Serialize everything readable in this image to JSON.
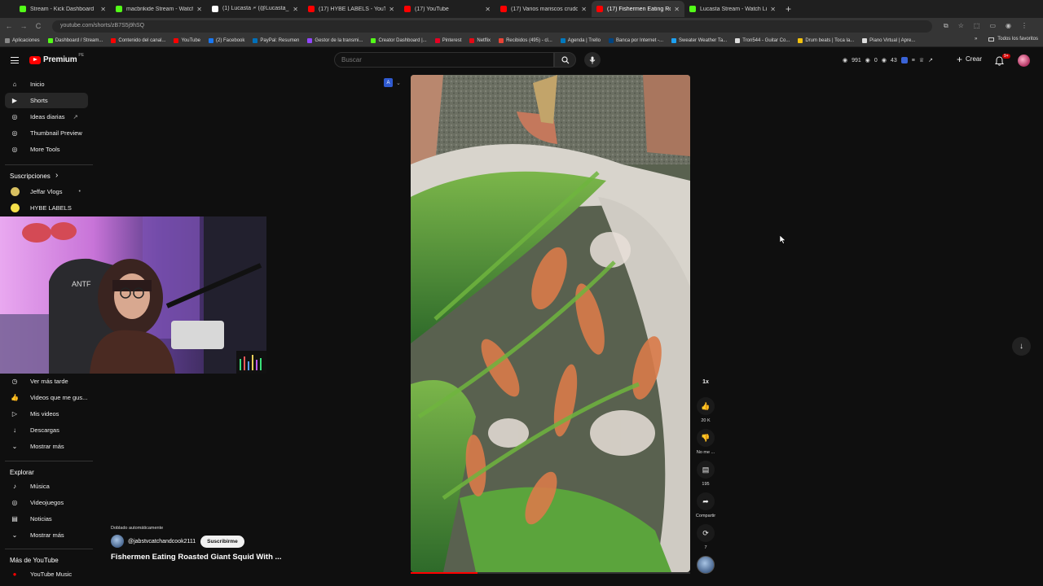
{
  "browser": {
    "tabs": [
      {
        "label": "Stream - Kick Dashboard",
        "favicon_color": "#53fc18",
        "close": "✕"
      },
      {
        "label": "macbrikide Stream - Watch Live",
        "favicon_color": "#53fc18",
        "close": "✕"
      },
      {
        "label": "(1) Lucasta 🗲 (@Lucasta_1) / X",
        "favicon_color": "#ffffff",
        "close": "✕"
      },
      {
        "label": "(17) HYBE LABELS - YouTube",
        "favicon_color": "#ff0000",
        "close": "✕"
      },
      {
        "label": "(17) YouTube",
        "favicon_color": "#ff0000",
        "close": "✕"
      },
      {
        "label": "(17) Varios mariscos crudos M...",
        "favicon_color": "#ff0000",
        "close": "✕"
      },
      {
        "label": "(17) Fishermen Eating Roas",
        "favicon_color": "#ff0000",
        "close": "✕",
        "active": true
      },
      {
        "label": "Lucasta Stream - Watch Live o",
        "favicon_color": "#53fc18",
        "close": "✕"
      }
    ],
    "new_tab": "+",
    "nav": {
      "back": "←",
      "forward": "→",
      "reload": "C"
    },
    "url": "youtube.com/shorts/zB7S5j9hSQ",
    "bookmarks": [
      {
        "label": "Aplicaciones",
        "color": "#888888"
      },
      {
        "label": "Dashboard / Stream...",
        "color": "#53fc18"
      },
      {
        "label": "Contenido del canal...",
        "color": "#ff0000"
      },
      {
        "label": "YouTube",
        "color": "#ff0000"
      },
      {
        "label": "(2) Facebook",
        "color": "#1877f2"
      },
      {
        "label": "PayPal: Resumen",
        "color": "#0070ba"
      },
      {
        "label": "Gestor de la transmi...",
        "color": "#9146ff"
      },
      {
        "label": "Creator Dashboard |...",
        "color": "#53fc18"
      },
      {
        "label": "Pinterest",
        "color": "#e60023"
      },
      {
        "label": "Netflix",
        "color": "#e50914"
      },
      {
        "label": "Recibidos (495) - cl...",
        "color": "#ea4335"
      },
      {
        "label": "Agenda | Trello",
        "color": "#0079bf"
      },
      {
        "label": "Banca por Internet -...",
        "color": "#004481"
      },
      {
        "label": "Sweater Weather Ta...",
        "color": "#1da1f2"
      },
      {
        "label": "Tron544 - Guitar Co...",
        "color": "#dddddd"
      },
      {
        "label": "Drum beats | Toca la...",
        "color": "#f4c20d"
      },
      {
        "label": "Piano Virtual | Apre...",
        "color": "#dddddd"
      }
    ],
    "bookmarks_more": "»",
    "all_bookmarks": "Todos los favoritos"
  },
  "youtube": {
    "logo_text": "Premium",
    "logo_sup": "PE",
    "search_placeholder": "Buscar",
    "stats": [
      "991",
      "0",
      "43"
    ],
    "create_label": "Crear",
    "notif_badge": "9+",
    "sidebar": {
      "main": [
        {
          "label": "Inicio",
          "icon": "home-icon",
          "glyph": "⌂"
        },
        {
          "label": "Shorts",
          "icon": "shorts-icon",
          "glyph": "▶",
          "active": true
        },
        {
          "label": "Ideas diarias",
          "icon": "lightbulb-icon",
          "glyph": "◎",
          "ext": "↗"
        },
        {
          "label": "Thumbnail Preview",
          "icon": "extension-icon",
          "glyph": "◎"
        },
        {
          "label": "More Tools",
          "icon": "tools-icon",
          "glyph": "◎"
        }
      ],
      "subs_header": "Suscripciones",
      "subs": [
        {
          "label": "Jeffar Vlogs",
          "color": "#d8c060",
          "dot": "•"
        },
        {
          "label": "HYBE LABELS",
          "color": "#f5e04a"
        }
      ],
      "you": [
        {
          "label": "Ver más tarde",
          "icon": "clock-icon",
          "glyph": "◷"
        },
        {
          "label": "Videos que me gus...",
          "icon": "like-icon",
          "glyph": "👍"
        },
        {
          "label": "Mis videos",
          "icon": "my-videos-icon",
          "glyph": "▷"
        },
        {
          "label": "Descargas",
          "icon": "download-icon",
          "glyph": "↓"
        },
        {
          "label": "Mostrar más",
          "icon": "chevron-down-icon",
          "glyph": "⌄"
        }
      ],
      "explore_header": "Explorar",
      "explore": [
        {
          "label": "Música",
          "icon": "music-icon",
          "glyph": "♪"
        },
        {
          "label": "Videojuegos",
          "icon": "gaming-icon",
          "glyph": "◎"
        },
        {
          "label": "Noticias",
          "icon": "news-icon",
          "glyph": "▤"
        },
        {
          "label": "Mostrar más",
          "icon": "chevron-down-icon",
          "glyph": "⌄"
        }
      ],
      "more_header": "Más de YouTube",
      "more": [
        {
          "label": "YouTube Music",
          "icon": "youtube-music-icon",
          "glyph": "●"
        }
      ]
    },
    "short": {
      "dub_label": "Doblado automáticamente",
      "channel": "@jabstvcatchandcook2111",
      "subscribe_label": "Suscribirme",
      "title": "Fishermen Eating Roasted Giant Squid With ...",
      "progress": 0.24,
      "actions": {
        "speed": "1x",
        "likes": "20 K",
        "dislike_label": "No me ...",
        "comments": "195",
        "share_label": "Compartir",
        "remix_count": "7"
      }
    }
  }
}
